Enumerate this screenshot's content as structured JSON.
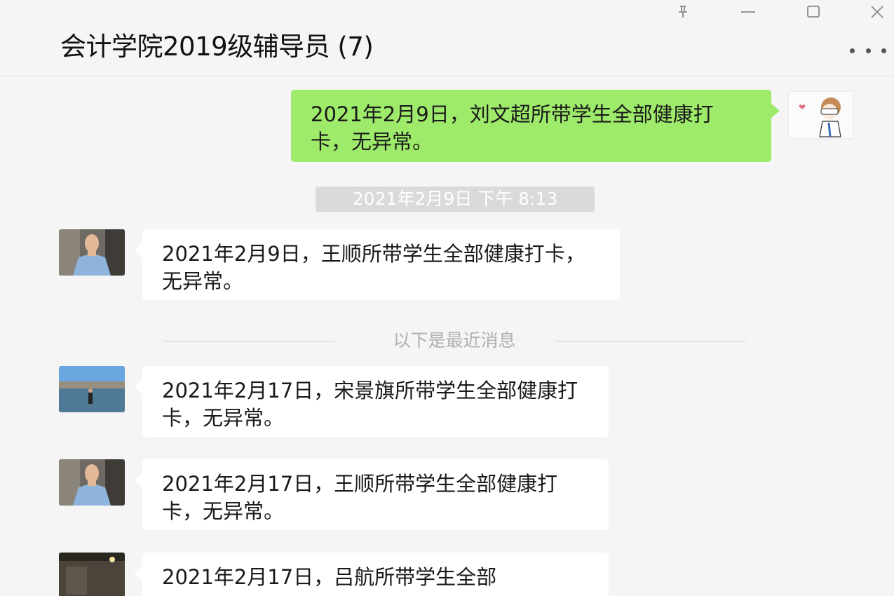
{
  "window": {
    "title": "会计学院2019级辅导员 (7)",
    "controls": {
      "pin_icon": "pin-icon",
      "minimize_icon": "minimize-icon",
      "maximize_icon": "maximize-icon",
      "close_icon": "close-icon",
      "more_icon": "more-icon"
    }
  },
  "messages": {
    "m1": {
      "side": "right",
      "text": "2021年2月9日，刘文超所带学生全部健康打卡，无异常。"
    },
    "timestamp": "2021年2月9日 下午 8:13",
    "m2": {
      "side": "left",
      "text": "2021年2月9日，王顺所带学生全部健康打卡，无异常。"
    },
    "divider": "以下是最近消息",
    "m3": {
      "side": "left",
      "text": "2021年2月17日，宋景旗所带学生全部健康打卡，无异常。"
    },
    "m4": {
      "side": "left",
      "text": "2021年2月17日，王顺所带学生全部健康打卡，无异常。"
    },
    "m5": {
      "side": "left",
      "text": "2021年2月17日，吕航所带学生全部"
    }
  },
  "colors": {
    "background": "#f5f5f5",
    "bubble_self": "#9eea6a",
    "bubble_other": "#ffffff",
    "timestamp_bg": "#dadada"
  }
}
